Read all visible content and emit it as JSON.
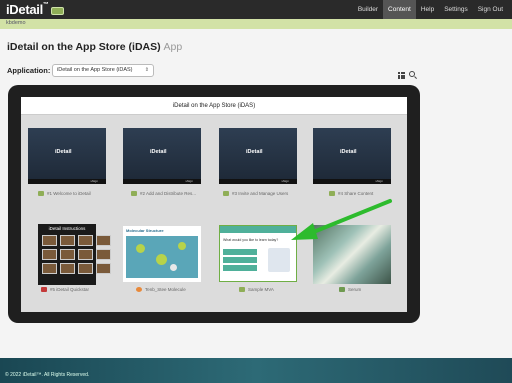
{
  "header": {
    "logo": "iDetail",
    "logo_tm": "™",
    "nav": [
      "Builder",
      "Content",
      "Help",
      "Settings",
      "Sign Out"
    ],
    "active_nav": "Content"
  },
  "subheader": {
    "user": "kbdemo"
  },
  "page": {
    "title": "iDetail on the App Store (iDAS)",
    "title_suffix": "App"
  },
  "application": {
    "label": "Application:",
    "selected": "iDetail on the App Store (iDAS)"
  },
  "screen": {
    "title": "iDetail on the App Store (iDAS)",
    "tiles": [
      {
        "caption": "#1 Welcome to iDetail",
        "thumb_title": "iDetail",
        "thumb_footer": "iAlign",
        "icon": "folder-icon"
      },
      {
        "caption": "#2 Add and Distribute Res...",
        "thumb_title": "iDetail",
        "thumb_footer": "iAlign",
        "icon": "folder-icon"
      },
      {
        "caption": "#3 Invite and Manage Users",
        "thumb_title": "iDetail",
        "thumb_footer": "iAlign",
        "icon": "folder-icon"
      },
      {
        "caption": "#4 Share Content",
        "thumb_title": "iDetail",
        "thumb_footer": "iAlign",
        "icon": "folder-icon"
      },
      {
        "caption": "#5 iDetail Quickstar",
        "thumb_title": "iDetail Instructions",
        "icon": "pdf-icon"
      },
      {
        "caption": "Tenb_Stee Molecule",
        "thumb_title": "Molecular Structure",
        "icon": "web-icon"
      },
      {
        "caption": "Sample MVA",
        "thumb_title": "What would you like to learn today?",
        "icon": "folder-icon"
      },
      {
        "caption": "Serum",
        "icon": "image-icon"
      }
    ]
  },
  "footer": {
    "copyright": "© 2022 iDetail™. All Rights Reserved."
  },
  "colors": {
    "accent": "#8fae57",
    "arrow": "#2dbb2d",
    "topbar": "#2a2a2a",
    "subbar": "#d2e2a6"
  }
}
